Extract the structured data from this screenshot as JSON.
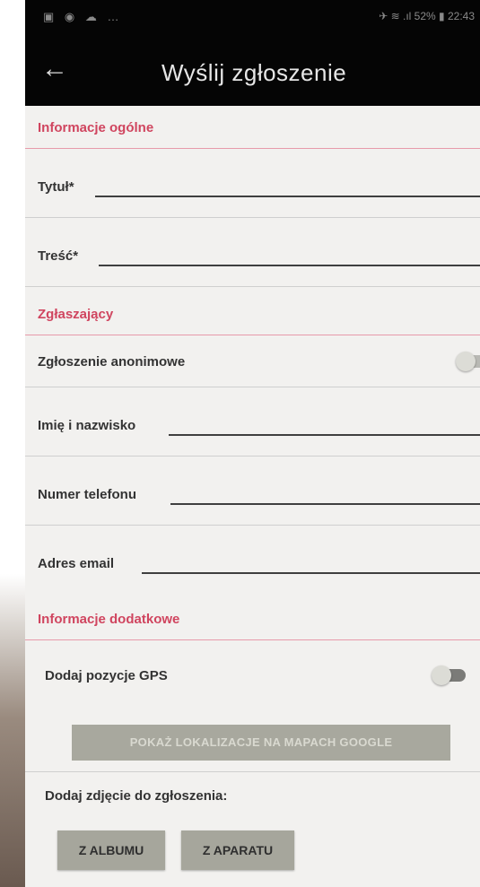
{
  "status_bar": {
    "left_icons": "▣ ◉ ☁ …",
    "right_text": "✈ ≋ .ıl 52% ▮ 22:43"
  },
  "toolbar": {
    "back_icon": "←",
    "title": "Wyślij zgłoszenie"
  },
  "sections": {
    "general": "Informacje ogólne",
    "reporter": "Zgłaszający",
    "additional": "Informacje dodatkowe"
  },
  "fields": {
    "title_label": "Tytuł*",
    "content_label": "Treść*",
    "name_label": "Imię i nazwisko",
    "phone_label": "Numer telefonu",
    "email_label": "Adres email"
  },
  "toggles": {
    "anonymous_label": "Zgłoszenie anonimowe",
    "anonymous_on": false,
    "gps_label": "Dodaj pozycje GPS",
    "gps_on": false
  },
  "buttons": {
    "show_maps": "POKAŻ LOKALIZACJE NA MAPACH GOOGLE",
    "add_photo_label": "Dodaj zdjęcie do zgłoszenia:",
    "from_album": "Z ALBUMU",
    "from_camera": "Z APARATU"
  },
  "colors": {
    "accent": "#d0455f",
    "toolbar_bg": "#050505",
    "button_bg": "#a8a89e"
  }
}
